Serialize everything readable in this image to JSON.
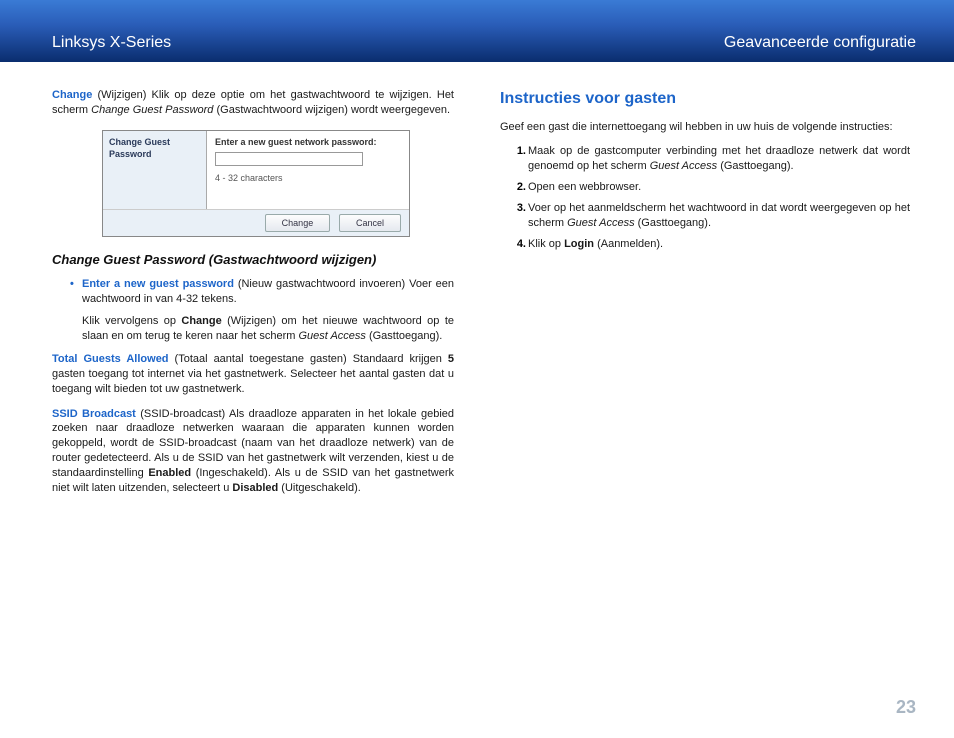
{
  "header": {
    "left": "Linksys X-Series",
    "right": "Geavanceerde configuratie"
  },
  "left_col": {
    "p1_lead": "Change",
    "p1_rest": " (Wijzigen) Klik op deze optie om het gastwachtwoord te wijzigen. Het scherm ",
    "p1_italic": "Change Guest Password",
    "p1_tail": " (Gastwachtwoord wijzigen) wordt weergegeven.",
    "screenshot": {
      "sidebar": "Change Guest Password",
      "prompt": "Enter a new guest network password:",
      "hint": "4 - 32 characters",
      "btn_change": "Change",
      "btn_cancel": "Cancel"
    },
    "subheading": "Change Guest Password (Gastwachtwoord wijzigen)",
    "bullet_lead": "Enter a new guest password",
    "bullet_rest": " (Nieuw gastwachtwoord invoeren) Voer een wachtwoord in van 4-32 tekens.",
    "indent_a": "Klik vervolgens op ",
    "indent_b_bold": "Change",
    "indent_c": " (Wijzigen) om het nieuwe wachtwoord op te slaan en om terug te keren naar het scherm ",
    "indent_italic": "Guest Access",
    "indent_tail": " (Gasttoegang).",
    "p2_lead": "Total Guests Allowed",
    "p2_a": " (Totaal aantal toegestane gasten) Standaard krijgen ",
    "p2_bold": "5",
    "p2_b": " gasten toegang tot internet via het gastnetwerk. Selecteer het aantal gasten dat u toegang wilt bieden tot uw gastnetwerk.",
    "p3_lead": "SSID Broadcast",
    "p3_a": " (SSID-broadcast) Als draadloze apparaten in het lokale gebied zoeken naar draadloze netwerken waaraan die apparaten kunnen worden gekoppeld, wordt de SSID-broadcast (naam van het draadloze netwerk) van de router gedetecteerd. Als u de SSID van het gastnetwerk wilt verzenden, kiest u de standaardinstelling ",
    "p3_b1": "Enabled",
    "p3_c": " (Ingeschakeld). Als u de SSID van het gastnetwerk niet wilt laten uitzenden, selecteert u ",
    "p3_b2": "Disabled",
    "p3_d": " (Uitgeschakeld)."
  },
  "right_col": {
    "heading": "Instructies voor gasten",
    "intro": "Geef een gast die internettoegang wil hebben in uw huis de volgende instructies:",
    "steps": {
      "s1a": "Maak op de gastcomputer verbinding met het draadloze netwerk dat wordt genoemd op het scherm ",
      "s1i": "Guest Access",
      "s1b": " (Gasttoegang).",
      "s2": "Open een webbrowser.",
      "s3a": "Voer op het aanmeldscherm het wachtwoord in dat wordt weergegeven op het scherm ",
      "s3i": "Guest Access",
      "s3b": " (Gasttoegang).",
      "s4a": "Klik op ",
      "s4bold": "Login",
      "s4b": " (Aanmelden)."
    },
    "nums": {
      "n1": "1.",
      "n2": "2.",
      "n3": "3.",
      "n4": "4."
    }
  },
  "page_number": "23"
}
